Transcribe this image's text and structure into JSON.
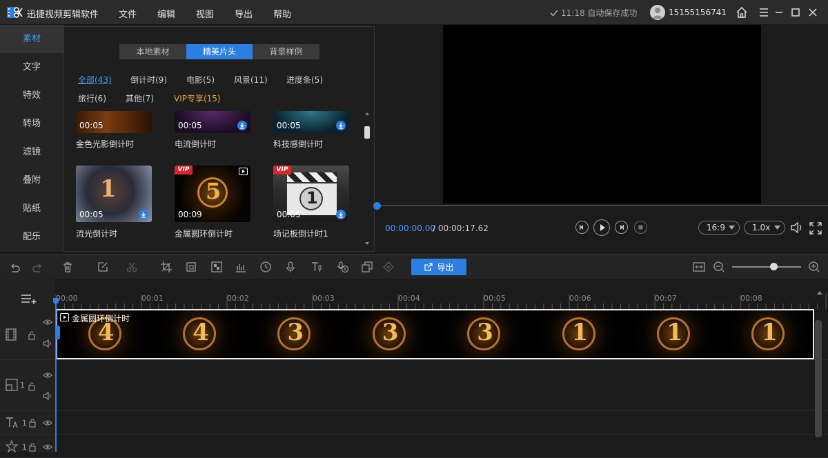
{
  "app": {
    "title": "迅捷视频剪辑软件"
  },
  "menu": {
    "file": "文件",
    "edit": "编辑",
    "view": "视图",
    "export": "导出",
    "help": "帮助"
  },
  "autosave": {
    "text": "11:18 自动保存成功"
  },
  "user": {
    "name": "15155156741"
  },
  "categories": [
    "素材",
    "文字",
    "特效",
    "转场",
    "滤镜",
    "叠附",
    "贴纸",
    "配乐"
  ],
  "tabs": [
    "本地素材",
    "精美片头",
    "背景样例"
  ],
  "filters": [
    "全部(43)",
    "倒计时(9)",
    "电影(5)",
    "风景(11)",
    "进度条(5)",
    "旅行(6)",
    "其他(7)",
    "VIP专享(15)"
  ],
  "thumbnails": [
    {
      "duration": "00:05",
      "label": "金色光影倒计时"
    },
    {
      "duration": "00:05",
      "label": "电流倒计时"
    },
    {
      "duration": "00:05",
      "label": "科技感倒计时"
    },
    {
      "duration": "00:05",
      "label": "流光倒计时",
      "number": "1"
    },
    {
      "duration": "00:09",
      "label": "金属圆环倒计时",
      "badge": "VIP",
      "number": "5"
    },
    {
      "duration": "00:05",
      "label": "场记板倒计时1",
      "badge": "VIP",
      "number": "1"
    }
  ],
  "player": {
    "current_time": "00:00:00.00",
    "total_time": "/ 00:00:17.62",
    "aspect_ratio": "16:9",
    "speed": "1.0x",
    "progress": 0
  },
  "toolbar": {
    "export_label": "导出",
    "zoom_level": 0.6
  },
  "timeline": {
    "ruler_labels": [
      "00:00",
      "00:01",
      "00:02",
      "00:03",
      "00:04",
      "00:05",
      "00:06",
      "00:07",
      "00:08"
    ],
    "clip_title": "金属圆环倒计时",
    "clip_frames": [
      "4",
      "4",
      "3",
      "3",
      "3",
      "1",
      "1",
      "1"
    ],
    "track_numbers": [
      "1",
      "1",
      "1"
    ]
  },
  "colors": {
    "accent": "#2b7fe3",
    "vip": "#e8a13b",
    "titlebar": "#2b2b2b"
  }
}
